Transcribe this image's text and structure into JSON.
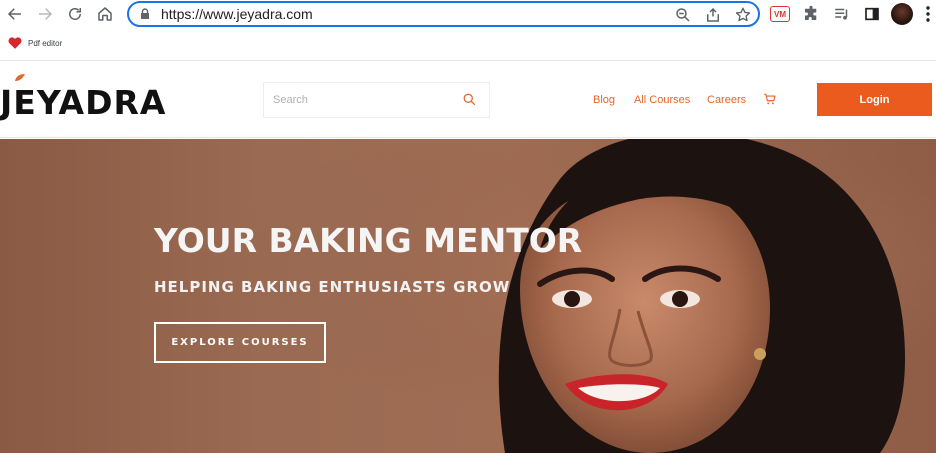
{
  "browser": {
    "url": "https://www.jeyadra.com",
    "extension_badge": "VM",
    "bookmarks": [
      {
        "label": "Pdf editor",
        "icon": "heart-icon"
      }
    ]
  },
  "site": {
    "brand": "JEYADRA",
    "search_placeholder": "Search",
    "nav": {
      "blog": "Blog",
      "all_courses": "All Courses",
      "careers": "Careers"
    },
    "login_label": "Login",
    "accent_color": "#eb5b1e"
  },
  "hero": {
    "title": "YOUR BAKING MENTOR",
    "subtitle": "HELPING BAKING ENTHUSIASTS GROW",
    "cta_label": "EXPLORE COURSES"
  }
}
